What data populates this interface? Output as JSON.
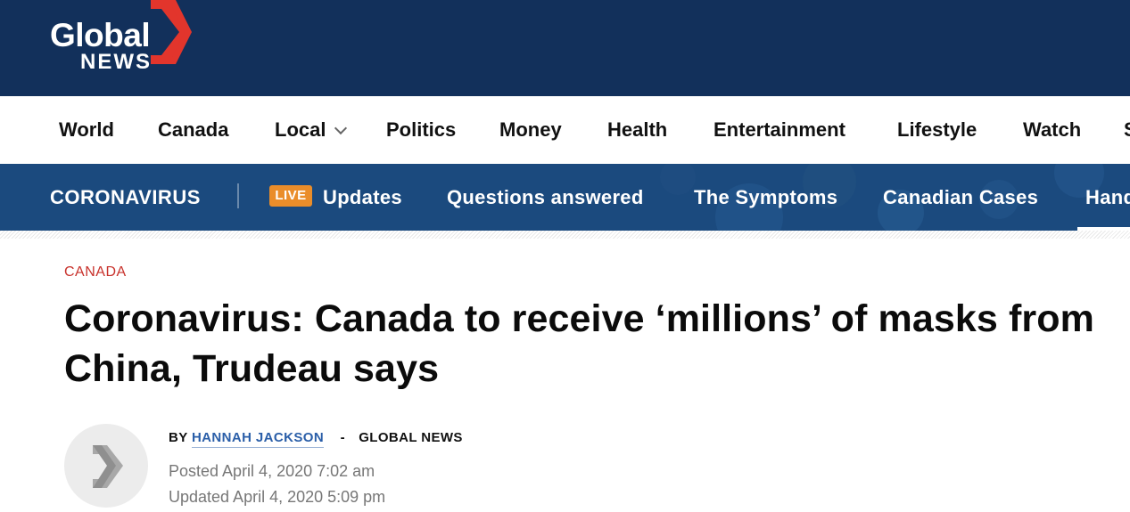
{
  "header": {
    "logo_line1": "Global",
    "logo_line2": "NEWS",
    "background_color": "#12305b",
    "arrow_color": "#e2352c"
  },
  "main_nav": {
    "items": [
      {
        "label": "World"
      },
      {
        "label": "Canada"
      },
      {
        "label": "Local",
        "has_dropdown": true
      },
      {
        "label": "Politics"
      },
      {
        "label": "Money"
      },
      {
        "label": "Health"
      },
      {
        "label": "Entertainment"
      },
      {
        "label": "Lifestyle"
      },
      {
        "label": "Watch"
      },
      {
        "label": "S"
      }
    ]
  },
  "covid_nav": {
    "title": "CORONAVIRUS",
    "live_badge": "LIVE",
    "items": [
      {
        "label": "Updates"
      },
      {
        "label": "Questions answered"
      },
      {
        "label": "The Symptoms"
      },
      {
        "label": "Canadian Cases"
      },
      {
        "label": "Hand"
      }
    ],
    "background_color": "#1b4a7e",
    "badge_color": "#ea8d2a"
  },
  "article": {
    "category": "CANADA",
    "headline": "Coronavirus: Canada to receive ‘millions’ of masks from China, Trudeau says",
    "byline_prefix": "BY",
    "author": "HANNAH JACKSON",
    "separator": "-",
    "source": "GLOBAL NEWS",
    "posted": "Posted April 4, 2020 7:02 am",
    "updated": "Updated April 4, 2020 5:09 pm",
    "category_color": "#c8312b",
    "author_color": "#2a5ea8"
  }
}
